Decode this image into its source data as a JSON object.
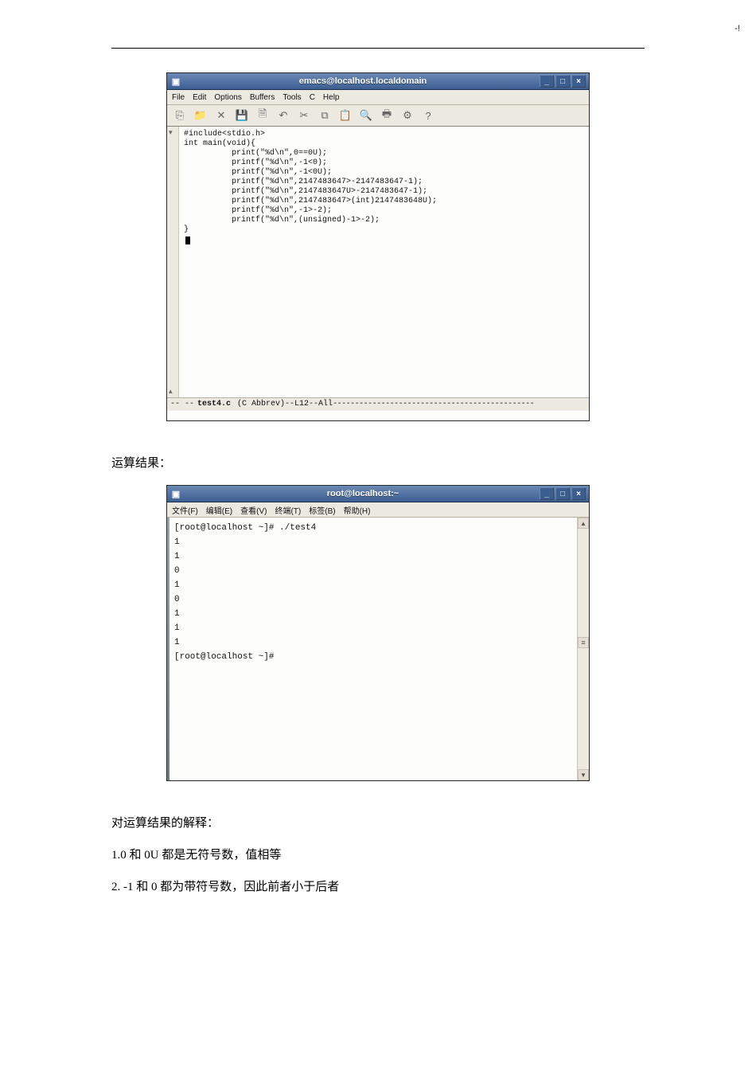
{
  "page_marker": "-!",
  "emacs": {
    "title": "emacs@localhost.localdomain",
    "win_min": "_",
    "win_max": "□",
    "win_close": "×",
    "menus": [
      "File",
      "Edit",
      "Options",
      "Buffers",
      "Tools",
      "C",
      "Help"
    ],
    "toolbar_icons": [
      "file-open-icon",
      "folder-icon",
      "close-x-icon",
      "floppy-icon",
      "save-as-icon",
      "undo-icon",
      "cut-icon",
      "copy-icon",
      "paste-icon",
      "search-icon",
      "print-icon",
      "preferences-icon",
      "help-icon"
    ],
    "code_lines": [
      "#include<stdio.h>",
      "int main(void){",
      "          print(\"%d\\n\",0==0U);",
      "          printf(\"%d\\n\",-1<0);",
      "          printf(\"%d\\n\",-1<0U);",
      "          printf(\"%d\\n\",2147483647>-2147483647-1);",
      "          printf(\"%d\\n\",2147483647U>-2147483647-1);",
      "          printf(\"%d\\n\",2147483647>(int)2147483648U);",
      "          printf(\"%d\\n\",-1>-2);",
      "          printf(\"%d\\n\",(unsigned)-1>-2);",
      "}"
    ],
    "gutter_top": "▾",
    "gutter_bot": "▴",
    "modeline_prefix": "-- --",
    "modeline_file": "test4.c",
    "modeline_mode": "(C Abbrev)--L12--All",
    "modeline_dashes": "----------------------------------------------"
  },
  "text": {
    "result_label": "运算结果：",
    "explain_title": "对运算结果的解释：",
    "line1": "1.0 和 0U 都是无符号数，值相等",
    "line2": "2. -1 和 0 都为带符号数，因此前者小于后者"
  },
  "terminal": {
    "title": "root@localhost:~",
    "win_min": "_",
    "win_max": "□",
    "win_close": "×",
    "menus": [
      "文件(F)",
      "编辑(E)",
      "查看(V)",
      "终端(T)",
      "标签(B)",
      "帮助(H)"
    ],
    "prompt1": "[root@localhost ~]# ./test4",
    "outputs": [
      "1",
      "1",
      "0",
      "1",
      "0",
      "1",
      "1",
      "1"
    ],
    "prompt2": "[root@localhost ~]#"
  }
}
